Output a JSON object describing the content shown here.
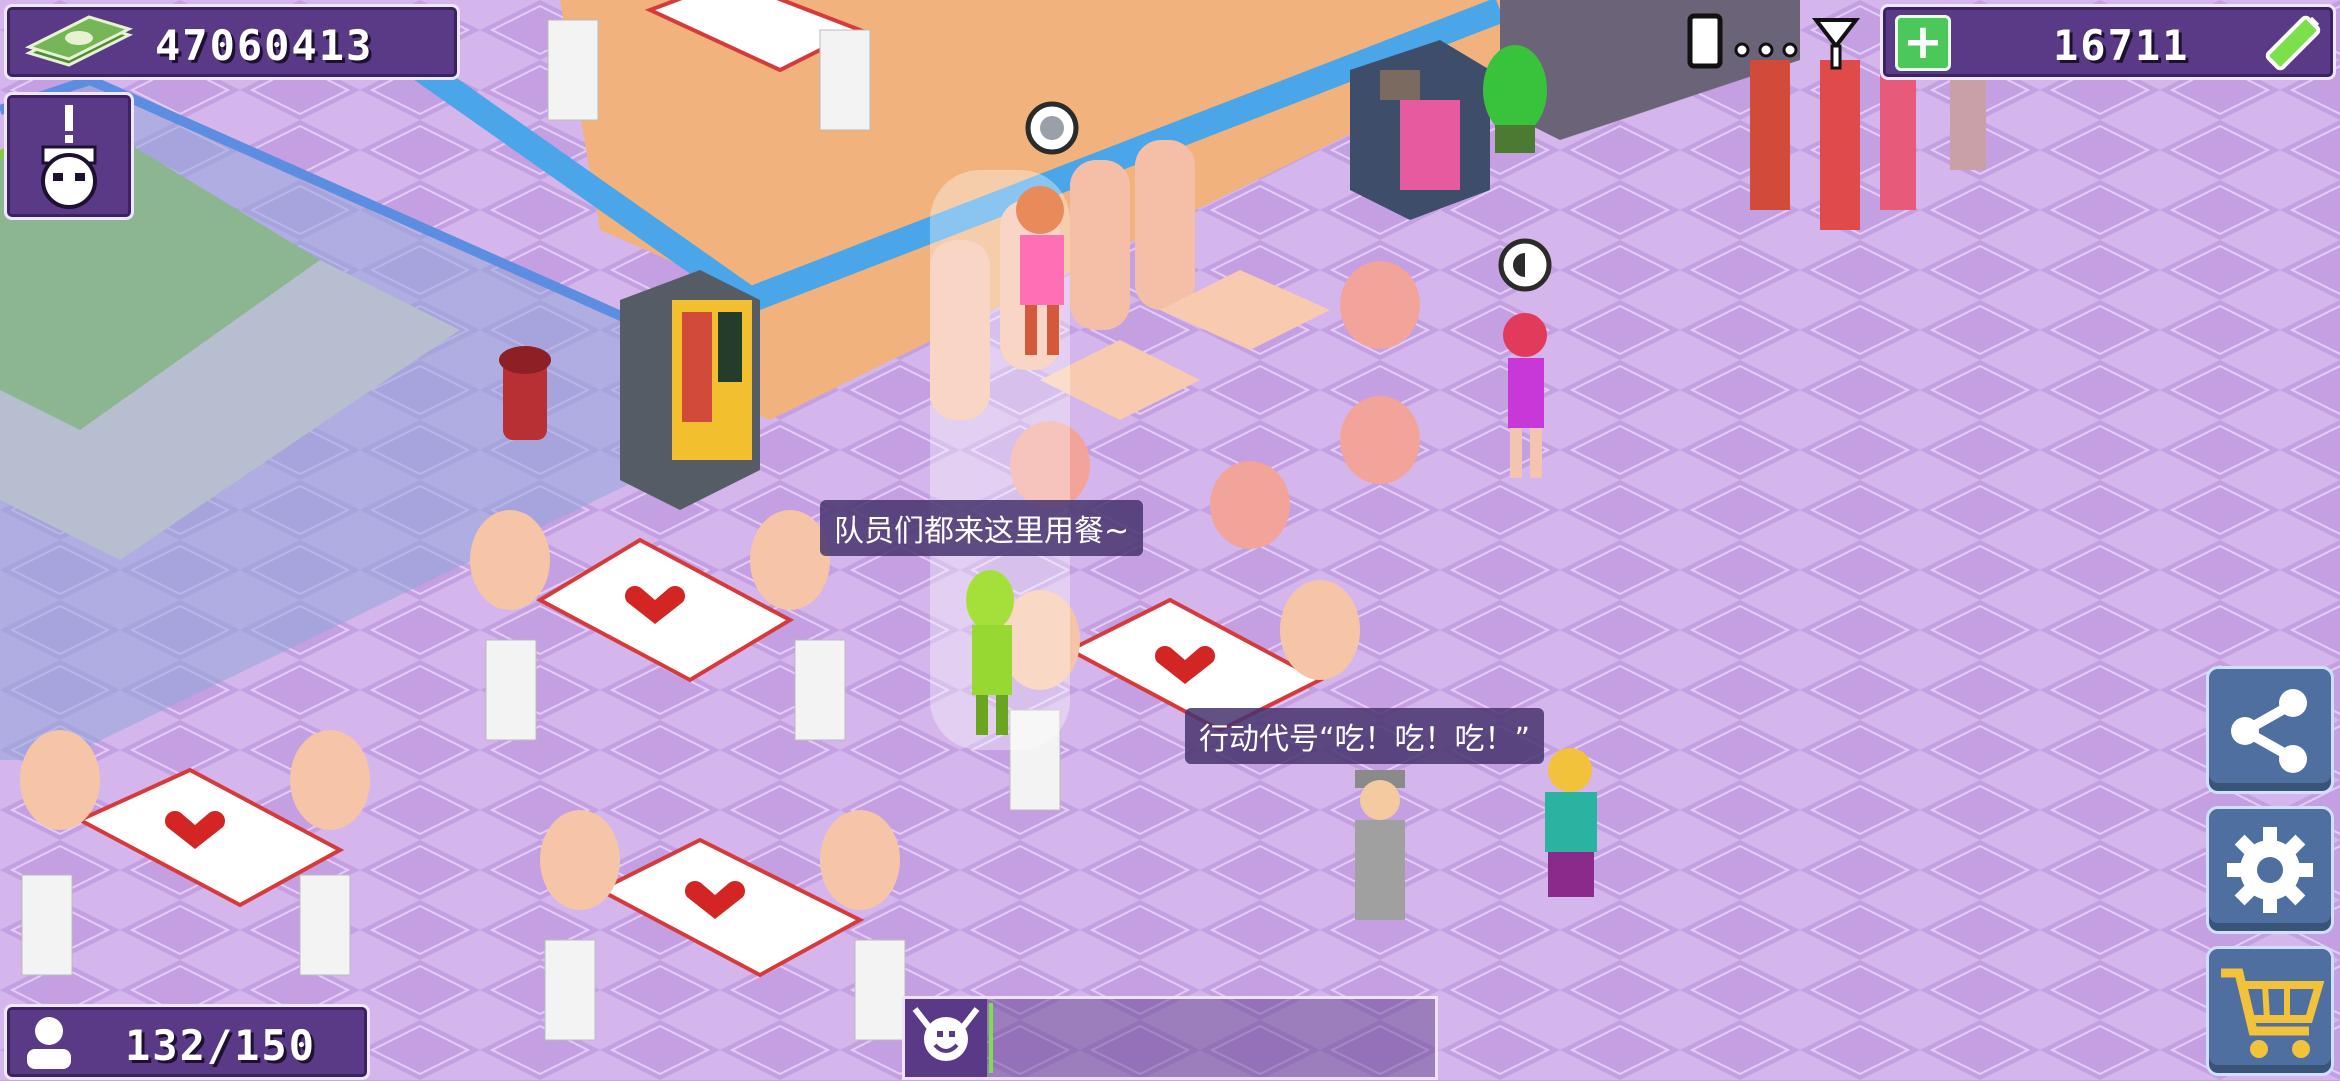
{
  "hud": {
    "money": "47060413",
    "gems": "16711",
    "population": "132/150",
    "add_gems_label": "+"
  },
  "dialogs": {
    "speech_1": "队员们都来这里用餐~",
    "speech_2": "行动代号“吃！吃！吃！”"
  },
  "icons": {
    "money": "cash-stack-icon",
    "alert": "alert-character-icon",
    "battery": "battery-icon",
    "signal": "signal-status-icon",
    "share": "share-icon",
    "settings": "gear-icon",
    "shop": "shopping-cart-icon",
    "population": "person-icon",
    "happiness": "happy-face-icon"
  },
  "colors": {
    "floor_light": "#d9bdf0",
    "floor_dark": "#c39ee0",
    "panel": "#5a3a86",
    "side_button": "#4e6fa0",
    "gem_plus": "#4cc75a",
    "battery": "#7be04b"
  },
  "progress": {
    "happiness_fraction": 0.01
  }
}
